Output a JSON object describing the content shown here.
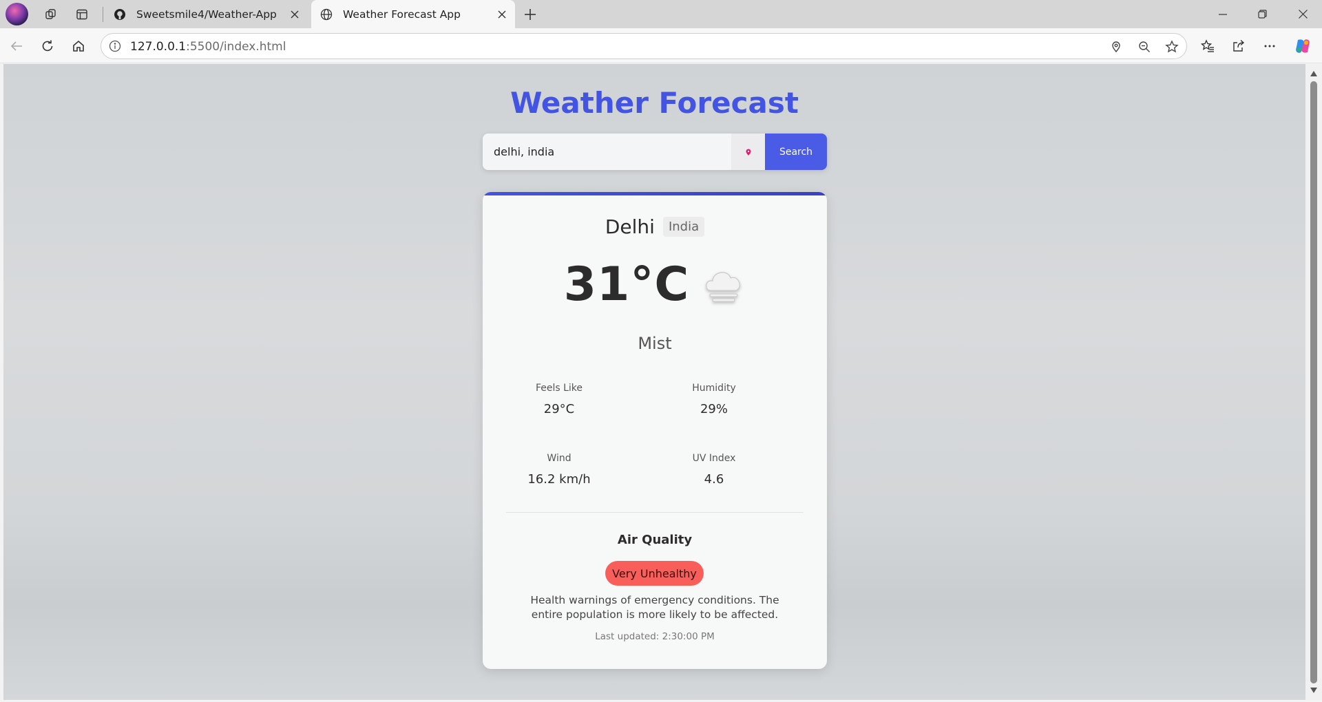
{
  "browser": {
    "tabs": [
      {
        "label": "Sweetsmile4/Weather-App",
        "active": false
      },
      {
        "label": "Weather Forecast App",
        "active": true
      }
    ],
    "url_host": "127.0.0.1",
    "url_rest": ":5500/index.html"
  },
  "page": {
    "title": "Weather Forecast",
    "search": {
      "value": "delhi, india",
      "button_label": "Search"
    }
  },
  "weather": {
    "city": "Delhi",
    "country": "India",
    "temperature": "31°C",
    "condition": "Mist",
    "icon": "mist-cloud-icon",
    "details": [
      {
        "label": "Feels Like",
        "value": "29°C"
      },
      {
        "label": "Humidity",
        "value": "29%"
      },
      {
        "label": "Wind",
        "value": "16.2 km/h"
      },
      {
        "label": "UV Index",
        "value": "4.6"
      }
    ],
    "air_quality": {
      "title": "Air Quality",
      "level": "Very Unhealthy",
      "level_color": "#f85f5a",
      "description": "Health warnings of emergency conditions. The entire population is more likely to be affected."
    },
    "last_updated": "Last updated: 2:30:00 PM"
  },
  "colors": {
    "accent": "#4353e2",
    "button": "#4a5be6"
  }
}
